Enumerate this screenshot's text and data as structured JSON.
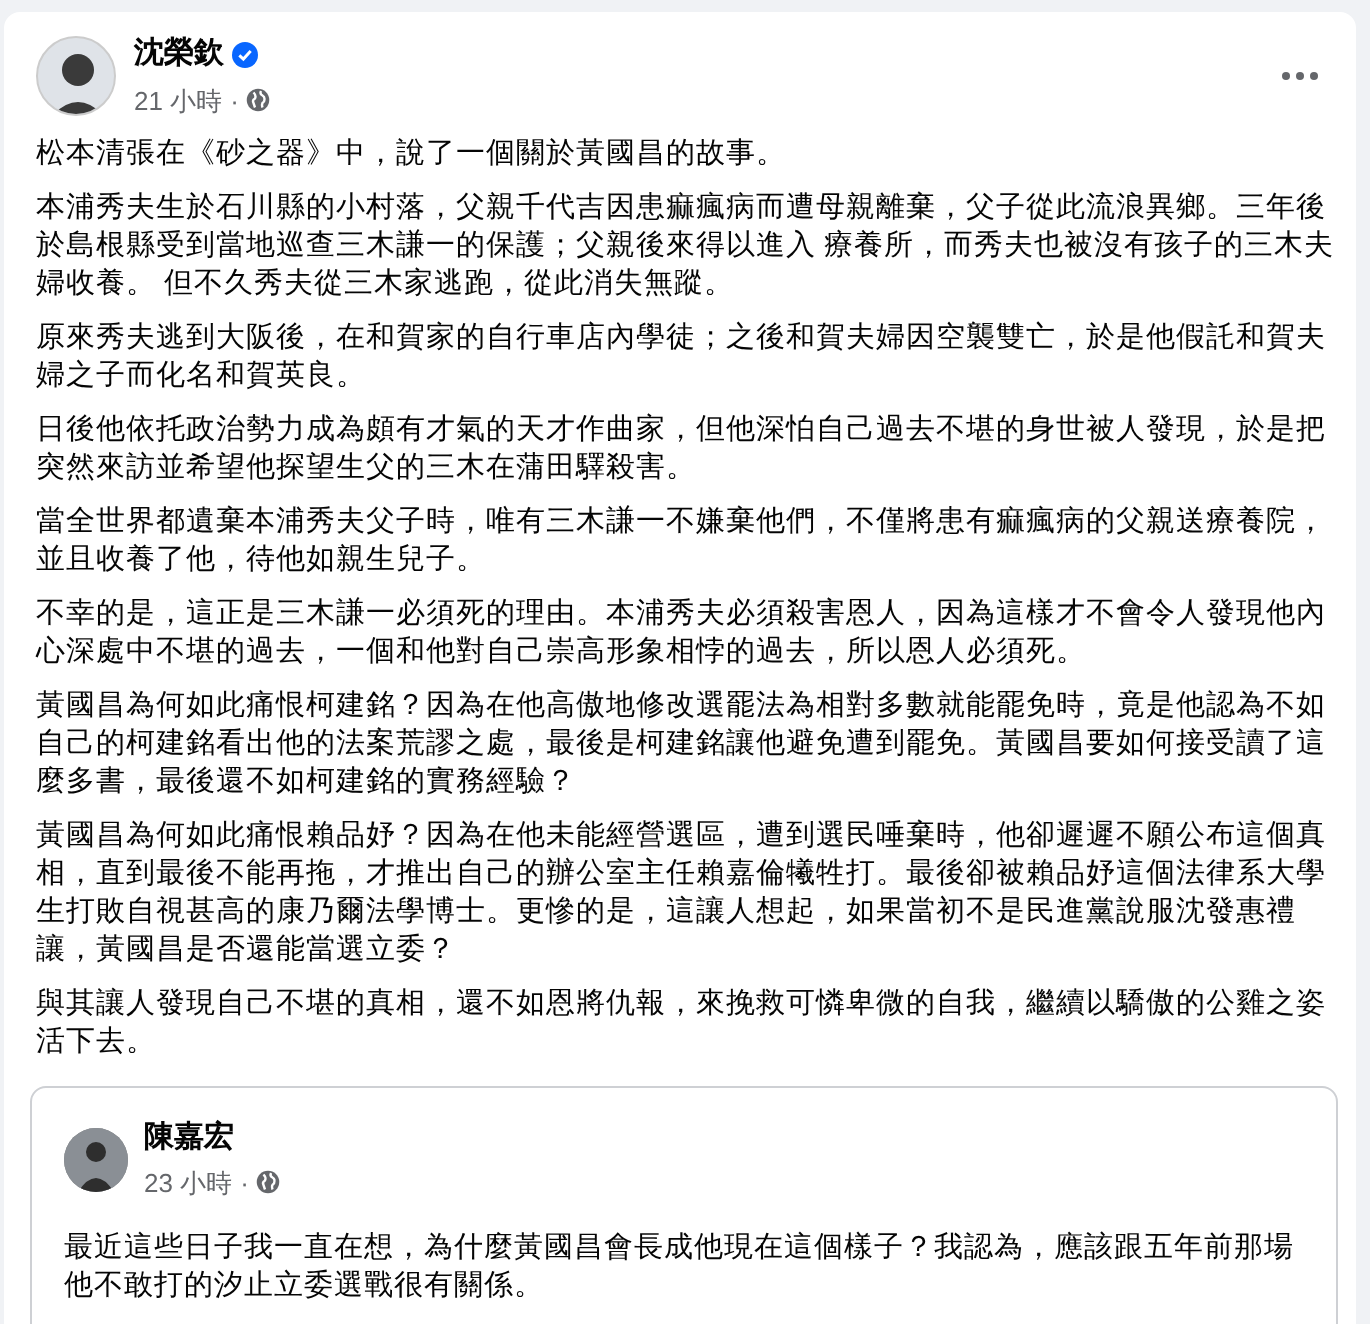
{
  "post": {
    "author": "沈榮欽",
    "verified": true,
    "time": "21 小時",
    "separator": "·",
    "paragraphs": [
      "松本清張在《砂之器》中，說了一個關於黃國昌的故事。",
      "本浦秀夫生於石川縣的小村落，父親千代吉因患痲瘋病而遭母親離棄，父子從此流浪異鄉。三年後於島根縣受到當地巡查三木謙一的保護；父親後來得以進入 療養所，而秀夫也被沒有孩子的三木夫婦收養。 但不久秀夫從三木家逃跑，從此消失無蹤。",
      "原來秀夫逃到大阪後，在和賀家的自行車店內學徒；之後和賀夫婦因空襲雙亡，於是他假託和賀夫婦之子而化名和賀英良。",
      "日後他依托政治勢力成為頗有才氣的天才作曲家，但他深怕自己過去不堪的身世被人發現，於是把突然來訪並希望他探望生父的三木在蒲田驛殺害。",
      "當全世界都遺棄本浦秀夫父子時，唯有三木謙一不嫌棄他們，不僅將患有痲瘋病的父親送療養院，並且收養了他，待他如親生兒子。",
      "不幸的是，這正是三木謙一必須死的理由。本浦秀夫必須殺害恩人，因為這樣才不會令人發現他內心深處中不堪的過去，一個和他對自己崇高形象相悖的過去，所以恩人必須死。",
      "黃國昌為何如此痛恨柯建銘？因為在他高傲地修改選罷法為相對多數就能罷免時，竟是他認為不如自己的柯建銘看出他的法案荒謬之處，最後是柯建銘讓他避免遭到罷免。黃國昌要如何接受讀了這麼多書，最後還不如柯建銘的實務經驗？",
      "黃國昌為何如此痛恨賴品妤？因為在他未能經營選區，遭到選民唾棄時，他卻遲遲不願公布這個真相，直到最後不能再拖，才推出自己的辦公室主任賴嘉倫犧牲打。最後卻被賴品妤這個法律系大學生打敗自視甚高的康乃爾法學博士。更慘的是，這讓人想起，如果當初不是民進黨說服沈發惠禮讓，黃國昌是否還能當選立委？",
      "與其讓人發現自己不堪的真相，還不如恩將仇報，來挽救可憐卑微的自我，繼續以驕傲的公雞之姿活下去。"
    ],
    "shared_post": {
      "author": "陳嘉宏",
      "time": "23 小時",
      "separator": "·",
      "text": "最近這些日子我一直在想，為什麼黃國昌會長成他現在這個樣子？我認為，應該跟五年前那場他不敢打的汐止立委選戰很有關係。"
    }
  }
}
